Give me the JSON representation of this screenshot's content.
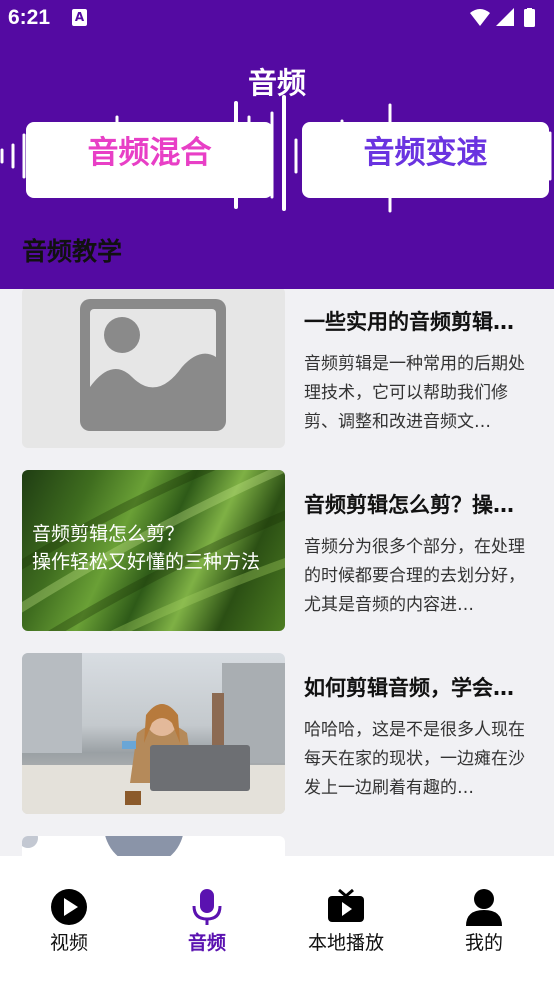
{
  "status_bar": {
    "time": "6:21",
    "notification_badge": "A"
  },
  "header": {
    "title": "音频",
    "background_color": "#540aa2",
    "buttons": [
      {
        "label": "音频混合",
        "color": "#e83fc6"
      },
      {
        "label": "音频变速",
        "color": "#6a33e0"
      }
    ]
  },
  "section": {
    "title": "音频教学"
  },
  "articles": [
    {
      "title": "一些实用的音频剪辑…",
      "description": "音频剪辑是一种常用的后期处理技术，它可以帮助我们修剪、调整和改进音频文…",
      "thumbnail": "image-placeholder-icon"
    },
    {
      "title": "音频剪辑怎么剪？操…",
      "description": "音频分为很多个部分，在处理的时候都要合理的去划分好，尤其是音频的内容进…",
      "thumbnail": "green-grass-image",
      "thumbnail_text_line1": "音频剪辑怎么剪？",
      "thumbnail_text_line2": "操作轻松又好懂的三种方法"
    },
    {
      "title": "如何剪辑音频，学会…",
      "description": "哈哈哈，这是不是很多人现在每天在家的现状，一边瘫在沙发上一边刷着有趣的…",
      "thumbnail": "woman-laptop-photo"
    }
  ],
  "bottom_nav": {
    "items": [
      {
        "label": "视频",
        "icon": "play-circle-icon"
      },
      {
        "label": "音频",
        "icon": "microphone-icon",
        "active": true
      },
      {
        "label": "本地播放",
        "icon": "tv-play-icon"
      },
      {
        "label": "我的",
        "icon": "person-icon"
      }
    ],
    "active_color": "#5a12b0"
  }
}
